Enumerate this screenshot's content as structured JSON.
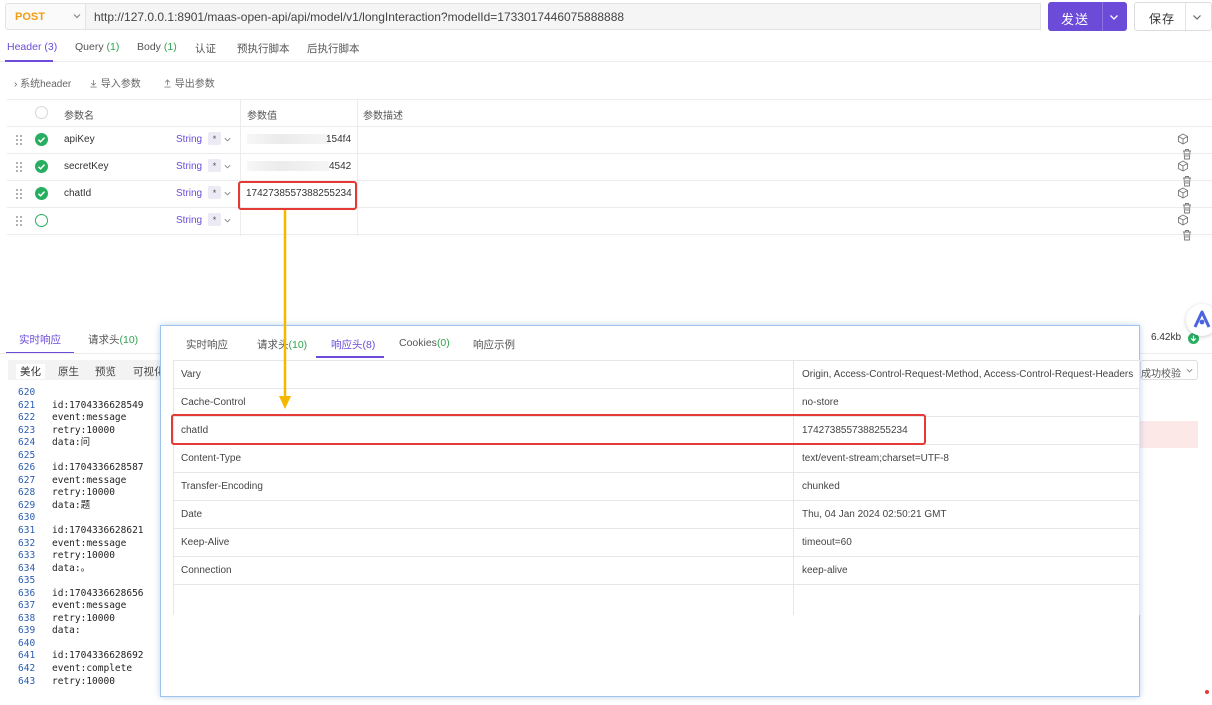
{
  "request": {
    "method": "POST",
    "url": "http://127.0.0.1:8901/maas-open-api/api/model/v1/longInteraction?modelId=1733017446075888888",
    "send_label": "发送",
    "save_label": "保存"
  },
  "req_tabs": [
    {
      "label": "Header",
      "count": "(3)"
    },
    {
      "label": "Query",
      "count": "(1)"
    },
    {
      "label": "Body",
      "count": "(1)"
    },
    {
      "label": "认证",
      "count": ""
    },
    {
      "label": "预执行脚本",
      "count": ""
    },
    {
      "label": "后执行脚本",
      "count": ""
    }
  ],
  "toolbar": {
    "system_header": "系统header",
    "import": "导入参数",
    "export": "导出参数"
  },
  "params_table": {
    "headers": {
      "name": "参数名",
      "value": "参数值",
      "desc": "参数描述"
    },
    "rows": [
      {
        "name": "apiKey",
        "type": "String",
        "required": "*",
        "value_suffix": "154f4",
        "checked": true
      },
      {
        "name": "secretKey",
        "type": "String",
        "required": "*",
        "value_suffix": "4542",
        "checked": true
      },
      {
        "name": "chatId",
        "type": "String",
        "required": "*",
        "value": "1742738557388255234",
        "checked": true
      },
      {
        "name": "",
        "type": "String",
        "required": "*",
        "value": "",
        "checked": false
      }
    ]
  },
  "response": {
    "tabs": [
      {
        "label": "实时响应",
        "count": ""
      },
      {
        "label": "请求头",
        "count": "(10)"
      }
    ],
    "formats": [
      "美化",
      "原生",
      "预览",
      "可视化"
    ],
    "size": "6.42kb",
    "verify_label": "成功校验",
    "code_lines": [
      {
        "n": "620",
        "t": ""
      },
      {
        "n": "621",
        "t": "id:1704336628549"
      },
      {
        "n": "622",
        "t": "event:message"
      },
      {
        "n": "623",
        "t": "retry:10000"
      },
      {
        "n": "624",
        "t": "data:问"
      },
      {
        "n": "625",
        "t": ""
      },
      {
        "n": "626",
        "t": "id:1704336628587"
      },
      {
        "n": "627",
        "t": "event:message"
      },
      {
        "n": "628",
        "t": "retry:10000"
      },
      {
        "n": "629",
        "t": "data:题"
      },
      {
        "n": "630",
        "t": ""
      },
      {
        "n": "631",
        "t": "id:1704336628621"
      },
      {
        "n": "632",
        "t": "event:message"
      },
      {
        "n": "633",
        "t": "retry:10000"
      },
      {
        "n": "634",
        "t": "data:。"
      },
      {
        "n": "635",
        "t": ""
      },
      {
        "n": "636",
        "t": "id:1704336628656"
      },
      {
        "n": "637",
        "t": "event:message"
      },
      {
        "n": "638",
        "t": "retry:10000"
      },
      {
        "n": "639",
        "t": "data:"
      },
      {
        "n": "640",
        "t": ""
      },
      {
        "n": "641",
        "t": "id:1704336628692"
      },
      {
        "n": "642",
        "t": "event:complete"
      },
      {
        "n": "643",
        "t": "retry:10000"
      }
    ]
  },
  "popup": {
    "tabs": [
      {
        "label": "实时响应",
        "count": ""
      },
      {
        "label": "请求头",
        "count": "(10)"
      },
      {
        "label": "响应头",
        "count": "(8)"
      },
      {
        "label": "Cookies",
        "count": "(0)"
      },
      {
        "label": "响应示例",
        "count": ""
      }
    ],
    "headers": [
      {
        "name": "Vary",
        "value": "Origin, Access-Control-Request-Method, Access-Control-Request-Headers"
      },
      {
        "name": "Cache-Control",
        "value": "no-store"
      },
      {
        "name": "chatId",
        "value": "1742738557388255234"
      },
      {
        "name": "Content-Type",
        "value": "text/event-stream;charset=UTF-8"
      },
      {
        "name": "Transfer-Encoding",
        "value": "chunked"
      },
      {
        "name": "Date",
        "value": "Thu, 04 Jan 2024 02:50:21 GMT"
      },
      {
        "name": "Keep-Alive",
        "value": "timeout=60"
      },
      {
        "name": "Connection",
        "value": "keep-alive"
      }
    ]
  },
  "colors": {
    "accent": "#6b4bd8",
    "method": "#f39c12",
    "success": "#27ae60",
    "highlight": "#e53935",
    "arrow": "#f5b700"
  }
}
